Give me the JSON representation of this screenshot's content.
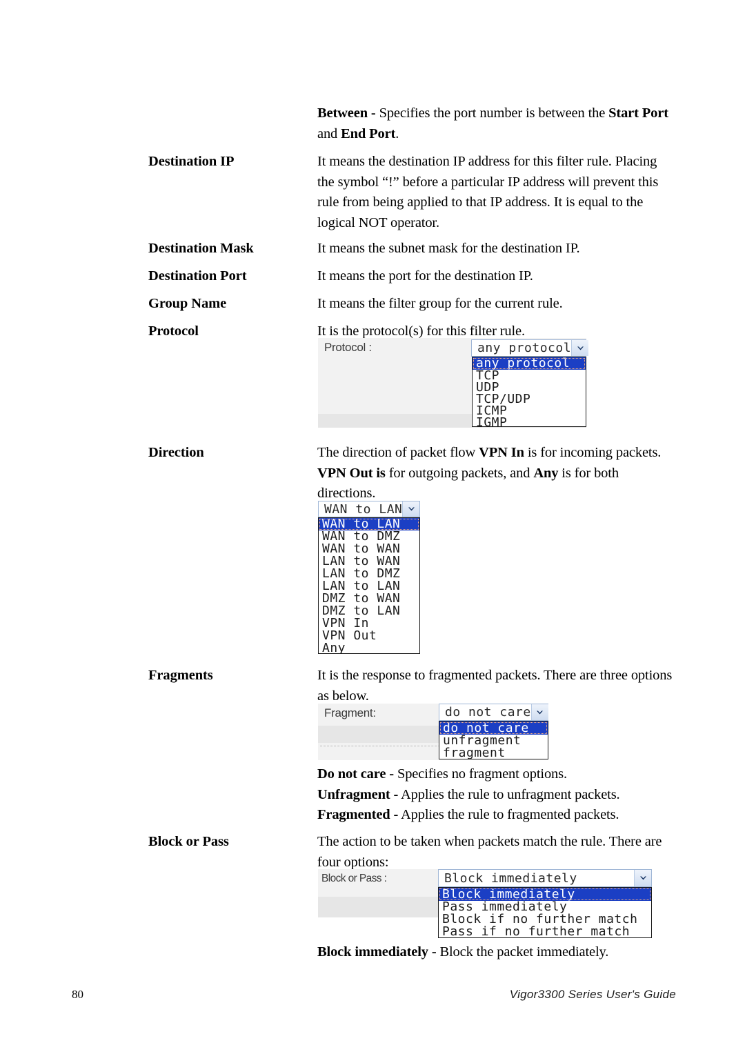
{
  "page": {
    "number": "80",
    "footer": "Vigor3300 Series User's Guide"
  },
  "intro": {
    "line1_bold": "Between -",
    "line1_rest": " Specifies the port number is between the ",
    "line1_bold2": "Start Port",
    "line2_rest": "and ",
    "line2_bold": "End Port",
    "line2_tail": "."
  },
  "entries": [
    {
      "term": "Destination IP",
      "lines": [
        "It means the destination IP address for this filter rule. Placing",
        "the symbol “!” before a particular IP address will prevent this",
        "rule from being applied to that IP address. It is equal to the",
        "logical NOT operator."
      ]
    },
    {
      "term": "Destination Mask",
      "lines": [
        "It means the subnet mask for the destination IP."
      ]
    },
    {
      "term": "Destination Port",
      "lines": [
        "It means the port for the destination IP."
      ]
    },
    {
      "term": "Group Name",
      "lines": [
        "It means the filter group for the current rule."
      ]
    },
    {
      "term": "Protocol",
      "lines": [
        "It is the protocol(s) for this filter rule."
      ]
    },
    {
      "term": "Direction",
      "lines": []
    },
    {
      "term": "Fragments",
      "lines": [
        "It is the response to fragmented packets. There are three options",
        "as below."
      ]
    },
    {
      "term": "Block or Pass",
      "lines": [
        "The action to be taken when packets match the rule. There are",
        "four options:"
      ]
    }
  ],
  "direction_desc": {
    "l1_a": "The direction of packet flow ",
    "l1_b": "VPN In",
    "l1_c": " is for incoming packets.",
    "l2_a": "VPN Out is",
    "l2_b": " for outgoing packets, and ",
    "l2_c": "Any",
    "l2_d": " is for both",
    "l3": "directions."
  },
  "protocol_widget": {
    "label": "Protocol :",
    "selected": "any protocol",
    "options": [
      "any protocol",
      "TCP",
      "UDP",
      "TCP/UDP",
      "ICMP",
      "IGMP"
    ]
  },
  "direction_widget": {
    "selected": "WAN to LAN",
    "options": [
      "WAN to LAN",
      "WAN to DMZ",
      "WAN to WAN",
      "LAN to WAN",
      "LAN to DMZ",
      "LAN to LAN",
      "DMZ to WAN",
      "DMZ to LAN",
      "VPN In",
      "VPN Out",
      "Any"
    ]
  },
  "fragment_widget": {
    "label": "Fragment:",
    "selected": "do not care",
    "options": [
      "do not care",
      "unfragment",
      "fragment"
    ]
  },
  "fragment_notes": [
    {
      "bold": "Do not care -",
      "rest": " Specifies no fragment options."
    },
    {
      "bold": "Unfragment -",
      "rest": " Applies the rule to unfragment packets."
    },
    {
      "bold": "Fragmented -",
      "rest": " Applies the rule to fragmented packets."
    }
  ],
  "blockpass_widget": {
    "label": "Block or Pass :",
    "selected": "Block immediately",
    "options": [
      "Block immediately",
      "Pass immediately",
      "Block if no further match",
      "Pass if no further match"
    ]
  },
  "blockpass_note": {
    "bold": "Block immediately -",
    "rest": " Block the packet immediately."
  }
}
